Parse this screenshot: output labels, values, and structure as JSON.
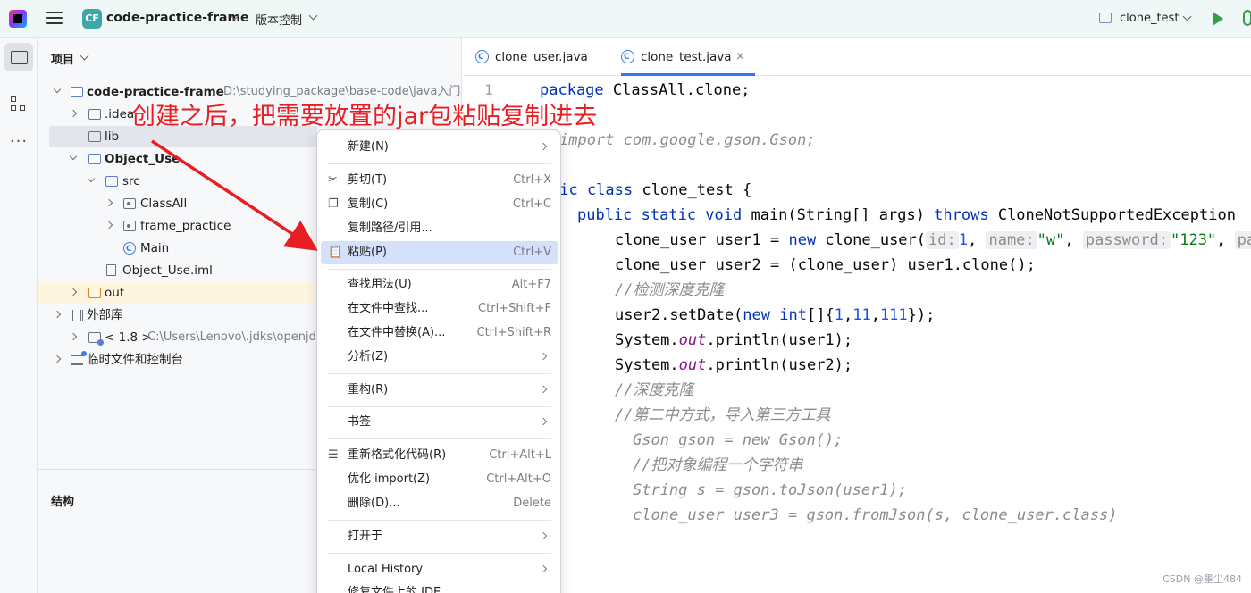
{
  "titlebar": {
    "project_badge": "CF",
    "project_name": "code-practice-frame",
    "vcs_label": "版本控制",
    "run_config": "clone_test"
  },
  "toolstrip": {
    "icons": [
      "folder-icon",
      "structure-icon",
      "more-icon"
    ],
    "more": "···"
  },
  "project_panel": {
    "title": "项目",
    "tree": [
      {
        "label": "code-practice-frame",
        "path": "D:\\studying_package\\base-code\\java入门"
      },
      {
        "label": ".idea"
      },
      {
        "label": "lib"
      },
      {
        "label": "Object_Use"
      },
      {
        "label": "src"
      },
      {
        "label": "ClassAll"
      },
      {
        "label": "frame_practice"
      },
      {
        "label": "Main"
      },
      {
        "label": "Object_Use.iml"
      },
      {
        "label": "out"
      },
      {
        "label": "外部库"
      },
      {
        "label": "< 1.8 >",
        "path": "C:\\Users\\Lenovo\\.jdks\\openjdk"
      },
      {
        "label": "临时文件和控制台"
      }
    ]
  },
  "structure_panel": {
    "title": "结构"
  },
  "editor": {
    "tabs": [
      {
        "label": "clone_user.java",
        "active": false
      },
      {
        "label": "clone_test.java",
        "active": true
      }
    ],
    "close_glyph": "×",
    "line_number": "1",
    "code": {
      "l1_kw": "package",
      "l1_rest": " ClassAll.clone;",
      "l3": "import com.google.gson.Gson;",
      "l5_kw": "lic class",
      "l5_rest": " clone_test {",
      "l6_kw": "public static void",
      "l6_mid": " main(String[] args) ",
      "l6_kw2": "throws",
      "l6_rest": " CloneNotSupportedException",
      "l7_a": "clone_user user1 = ",
      "l7_new": "new",
      "l7_b": " clone_user(",
      "l7_h1": "id:",
      "l7_n1": "1",
      "l7_c1": ", ",
      "l7_h2": "name:",
      "l7_s1": "\"w\"",
      "l7_c2": ", ",
      "l7_h3": "password:",
      "l7_s2": "\"123\"",
      "l7_c3": ", ",
      "l7_h4": "pas",
      "l8": "clone_user user2 = (clone_user) user1.clone();",
      "l9": "//检测深度克隆",
      "l10_a": "user2.setDate(",
      "l10_new": "new",
      "l10_sp": " ",
      "l10_int": "int",
      "l10_b": "[]{",
      "l10_n1": "1",
      "l10_c1": ",",
      "l10_n2": "11",
      "l10_c2": ",",
      "l10_n3": "111",
      "l10_c": "});",
      "l11_a": "System.",
      "l11_f": "out",
      "l11_b": ".println(user1);",
      "l12_a": "System.",
      "l12_f": "out",
      "l12_b": ".println(user2);",
      "l13": "//深度克隆",
      "l14": "//第二中方式，导入第三方工具",
      "l15": "Gson gson = new Gson();",
      "l16": "//把对象编程一个字符串",
      "l17": "String s = gson.toJson(user1);",
      "l18": "clone_user user3 = gson.fromJson(s, clone_user.class)"
    }
  },
  "context_menu": {
    "items": [
      {
        "label": "新建(N)",
        "shortcut": "",
        "submenu": true
      },
      {
        "label": "剪切(T)",
        "shortcut": "Ctrl+X",
        "icon": "scissors-icon"
      },
      {
        "label": "复制(C)",
        "shortcut": "Ctrl+C",
        "icon": "copy-icon"
      },
      {
        "label": "复制路径/引用...",
        "shortcut": ""
      },
      {
        "label": "粘贴(P)",
        "shortcut": "Ctrl+V",
        "icon": "paste-icon",
        "selected": true
      },
      {
        "label": "查找用法(U)",
        "shortcut": "Alt+F7"
      },
      {
        "label": "在文件中查找...",
        "shortcut": "Ctrl+Shift+F"
      },
      {
        "label": "在文件中替换(A)...",
        "shortcut": "Ctrl+Shift+R"
      },
      {
        "label": "分析(Z)",
        "shortcut": "",
        "submenu": true
      },
      {
        "label": "重构(R)",
        "shortcut": "",
        "submenu": true
      },
      {
        "label": "书签",
        "shortcut": "",
        "submenu": true
      },
      {
        "label": "重新格式化代码(R)",
        "shortcut": "Ctrl+Alt+L",
        "icon": "reformat-icon"
      },
      {
        "label": "优化 import(Z)",
        "shortcut": "Ctrl+Alt+O"
      },
      {
        "label": "删除(D)...",
        "shortcut": "Delete"
      },
      {
        "label": "打开于",
        "shortcut": "",
        "submenu": true
      },
      {
        "label": "Local History",
        "shortcut": "",
        "submenu": true
      },
      {
        "label": "修复文件上的 IDE",
        "shortcut": ""
      }
    ]
  },
  "annotation": {
    "text": "创建之后，把需要放置的jar包粘贴复制进去",
    "color": "#e81e24"
  },
  "watermark": "CSDN @墨尘484"
}
